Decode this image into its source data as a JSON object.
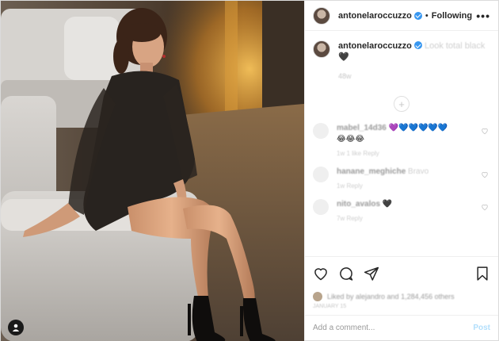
{
  "header": {
    "username": "antonelaroccuzzo",
    "separator": "•",
    "follow_label": "Following",
    "more_label": "•••"
  },
  "caption": {
    "username": "antonelaroccuzzo",
    "text": "Look total black",
    "emoji": "🖤",
    "time": "48w"
  },
  "load_more_label": "+",
  "comments": [
    {
      "username": "mabel_14d36",
      "text": "💜💙💙💙💙💙",
      "text2": "😂😂😂",
      "sub": "1w  1 like  Reply"
    },
    {
      "username": "hanane_meghiche",
      "text": "Bravo",
      "text2": "",
      "sub": "1w  Reply"
    },
    {
      "username": "nito_avalos",
      "text": "🖤",
      "text2": "",
      "sub": "7w  Reply"
    }
  ],
  "likes_text": "Liked by alejandro and 1,284,456 others",
  "date_text": "JANUARY 15",
  "add_comment": {
    "placeholder": "Add a comment...",
    "post_label": "Post"
  },
  "colors": {
    "verified": "#3897f0",
    "post_disabled": "#b2dffc",
    "border": "#efefef"
  }
}
